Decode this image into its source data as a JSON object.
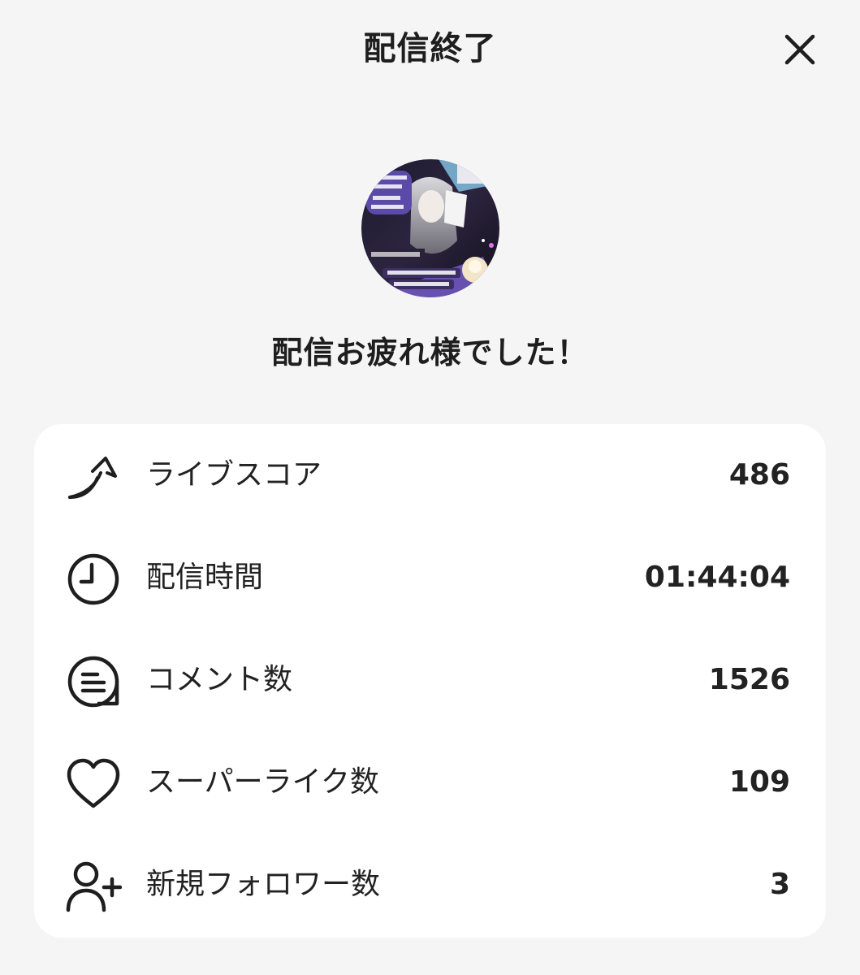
{
  "header": {
    "title": "配信終了",
    "close_icon": "close-icon"
  },
  "avatar": {
    "icon": "stream-avatar"
  },
  "message": "配信お疲れ様でした！",
  "stats": [
    {
      "label": "ライブスコア",
      "value": "486",
      "icon": "rising-arrow-icon"
    },
    {
      "label": "配信時間",
      "value": "01:44:04",
      "icon": "clock-icon"
    },
    {
      "label": "コメント数",
      "value": "1526",
      "icon": "comment-icon"
    },
    {
      "label": "スーパーライク数",
      "value": "109",
      "icon": "heart-icon"
    },
    {
      "label": "新規フォロワー数",
      "value": "3",
      "icon": "add-user-icon"
    }
  ],
  "colors": {
    "background": "#f5f5f5",
    "card": "#ffffff",
    "text": "#1e1e1e"
  }
}
